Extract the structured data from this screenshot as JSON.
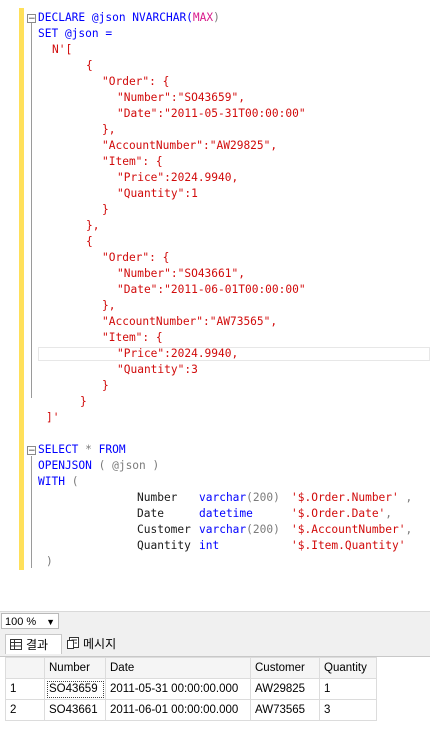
{
  "code": {
    "l1": {
      "a": "DECLARE @json NVARCHAR(",
      "b": "MAX",
      "c": ")"
    },
    "l2": {
      "a": "SET @json ="
    },
    "l3": {
      "a": "N'["
    },
    "l4": {
      "a": "{"
    },
    "l5": {
      "a": "\"Order\": {"
    },
    "l6": {
      "a": "\"Number\":\"SO43659\","
    },
    "l7": {
      "a": "\"Date\":\"2011-05-31T00:00:00\""
    },
    "l8": {
      "a": "},"
    },
    "l9": {
      "a": "\"AccountNumber\":\"AW29825\","
    },
    "l10": {
      "a": "\"Item\": {"
    },
    "l11": {
      "a": "\"Price\":2024.9940,"
    },
    "l12": {
      "a": "\"Quantity\":1"
    },
    "l13": {
      "a": "}"
    },
    "l14": {
      "a": "},"
    },
    "l15": {
      "a": "{"
    },
    "l16": {
      "a": "\"Order\": {"
    },
    "l17": {
      "a": "\"Number\":\"SO43661\","
    },
    "l18": {
      "a": "\"Date\":\"2011-06-01T00:00:00\""
    },
    "l19": {
      "a": "},"
    },
    "l20": {
      "a": "\"AccountNumber\":\"AW73565\","
    },
    "l21": {
      "a": "\"Item\": {"
    },
    "l22": {
      "a": "\"Price\":2024.9940,"
    },
    "l23": {
      "a": "\"Quantity\":3"
    },
    "l24": {
      "a": "}"
    },
    "l25": {
      "a": "}"
    },
    "l26": {
      "a": "]'"
    },
    "l27": {
      "a": "SELECT",
      "b": " * ",
      "c": "FROM"
    },
    "l28": {
      "a": "OPENJSON",
      "b": " ( @json )"
    },
    "l29": {
      "a": "WITH",
      "b": " ("
    },
    "l30": {
      "a": "Number",
      "b": "varchar",
      "c": "(200)",
      "d": "'$.Order.Number'",
      "e": ","
    },
    "l31": {
      "a": "Date",
      "b": "datetime",
      "d": "'$.Order.Date'",
      "e": ","
    },
    "l32": {
      "a": "Customer",
      "b": "varchar",
      "c": "(200)",
      "d": "'$.AccountNumber'",
      "e": ","
    },
    "l33": {
      "a": "Quantity",
      "b": "int",
      "d": "'$.Item.Quantity'"
    },
    "l34": {
      "a": ")"
    }
  },
  "zoom": {
    "value": "100 %"
  },
  "tabs": {
    "results": "결과",
    "messages": "메시지"
  },
  "grid": {
    "headers": [
      "Number",
      "Date",
      "Customer",
      "Quantity"
    ],
    "rows": [
      {
        "num": "1",
        "cells": [
          "SO43659",
          "2011-05-31 00:00:00.000",
          "AW29825",
          "1"
        ]
      },
      {
        "num": "2",
        "cells": [
          "SO43661",
          "2011-06-01 00:00:00.000",
          "AW73565",
          "3"
        ]
      }
    ]
  },
  "colors": {
    "keyword": "#0000ff",
    "string": "#d10b0b",
    "operator": "#7b7b7b",
    "function": "#d81c8c",
    "change_bar": "#ffe05a"
  }
}
